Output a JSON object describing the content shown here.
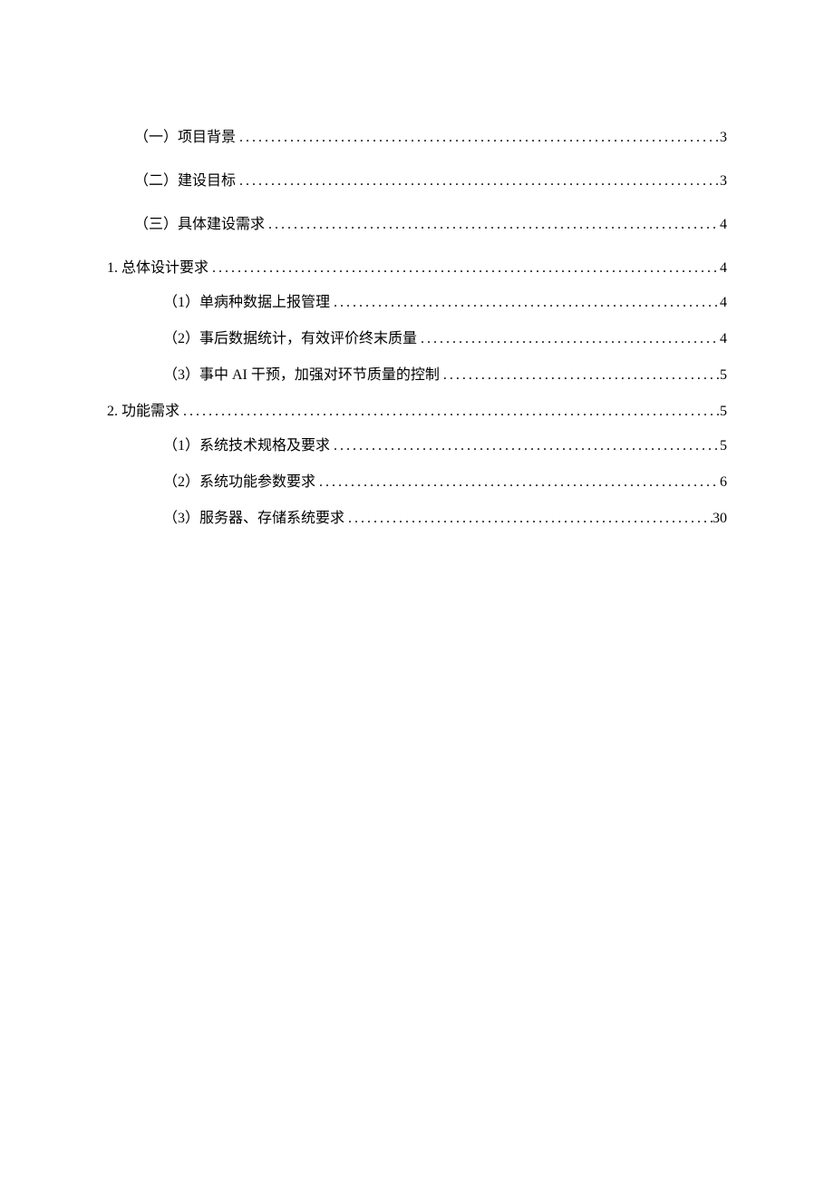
{
  "toc": [
    {
      "level": 1,
      "label": "（一）项目背景",
      "page": "3"
    },
    {
      "level": 1,
      "label": "（二）建设目标",
      "page": "3"
    },
    {
      "level": 1,
      "label": "（三）具体建设需求",
      "page": "4"
    },
    {
      "level": 2,
      "label": "1. 总体设计要求",
      "page": "4"
    },
    {
      "level": 3,
      "label": "（1）单病种数据上报管理",
      "page": "4"
    },
    {
      "level": 3,
      "label": "（2）事后数据统计，有效评价终末质量",
      "page": "4"
    },
    {
      "level": 3,
      "label": "（3）事中 AI 干预，加强对环节质量的控制",
      "page": "5"
    },
    {
      "level": 2,
      "label": "2. 功能需求",
      "page": "5"
    },
    {
      "level": 3,
      "label": "（1）系统技术规格及要求",
      "page": "5"
    },
    {
      "level": 3,
      "label": "（2）系统功能参数要求",
      "page": "6"
    },
    {
      "level": 3,
      "label": "（3）服务器、存储系统要求",
      "page": "30"
    }
  ]
}
